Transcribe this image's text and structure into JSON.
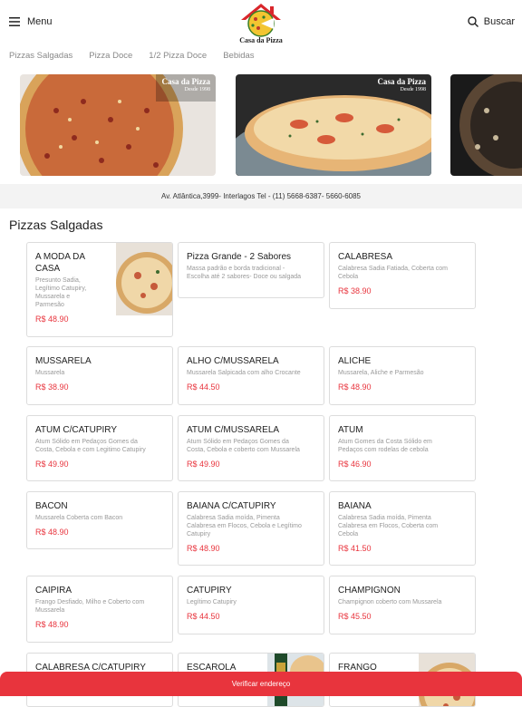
{
  "header": {
    "menu_label": "Menu",
    "logo_text": "Casa da Pizza",
    "search_label": "Buscar"
  },
  "tabs": [
    "Pizzas Salgadas",
    "Pizza Doce",
    "1/2 Pizza Doce",
    "Bebidas"
  ],
  "banners": [
    {
      "title": "Casa da Pizza",
      "subtitle": "Desde 1998"
    },
    {
      "title": "Casa da Pizza",
      "subtitle": "Desde 1998"
    }
  ],
  "address": "Av. Atlântica,3999- Interlagos Tel - (11) 5668-6387- 5660-6085",
  "section_title": "Pizzas Salgadas",
  "products": [
    {
      "name_lines": [
        "A MODA DA",
        "CASA"
      ],
      "desc_lines": [
        "Presunto Sadia,",
        "Legítimo Catupiry,",
        "Mussarela e",
        "Parmesão"
      ],
      "price": "R$ 48.90",
      "image": "pizza-photo"
    },
    {
      "name_lines": [
        "Pizza Grande - 2 Sabores"
      ],
      "desc_lines": [
        "Massa padrão e borda tradicional -",
        "Escolha até 2 sabores- Doce ou salgada"
      ],
      "price": ""
    },
    {
      "name_lines": [
        "CALABRESA"
      ],
      "desc_lines": [
        "Calabresa Sadia Fatiada, Coberta com",
        "Cebola"
      ],
      "price": "R$ 38.90"
    },
    {
      "name_lines": [
        "MUSSARELA"
      ],
      "desc_lines": [
        "Mussarela"
      ],
      "price": "R$ 38.90"
    },
    {
      "name_lines": [
        "ALHO C/MUSSARELA"
      ],
      "desc_lines": [
        "Mussarela Salpicada com alho Crocante"
      ],
      "price": "R$ 44.50"
    },
    {
      "name_lines": [
        "ALICHE"
      ],
      "desc_lines": [
        "Mussarela, Aliche e Parmesão"
      ],
      "price": "R$ 48.90"
    },
    {
      "name_lines": [
        "ATUM C/CATUPIRY"
      ],
      "desc_lines": [
        "Atum Sólido em Pedaços Gomes da",
        "Costa, Cebola e com Legitimo Catupiry"
      ],
      "price": "R$ 49.90"
    },
    {
      "name_lines": [
        "ATUM C/MUSSARELA"
      ],
      "desc_lines": [
        "Atum Sólido em Pedaços Gomes da",
        "Costa, Cebola e coberto com Mussarela"
      ],
      "price": "R$ 49.90"
    },
    {
      "name_lines": [
        "ATUM"
      ],
      "desc_lines": [
        "Atum Gomes da Costa Sólido em",
        "Pedaços com rodelas de cebola"
      ],
      "price": "R$ 46.90"
    },
    {
      "name_lines": [
        "BACON"
      ],
      "desc_lines": [
        "Mussarela Coberta com Bacon"
      ],
      "price": "R$ 48.90"
    },
    {
      "name_lines": [
        "BAIANA C/CATUPIRY"
      ],
      "desc_lines": [
        "Calabresa Sadia moída, Pimenta",
        "Calabresa em Flocos, Cebola e Legítimo",
        "Catupiry"
      ],
      "price": "R$ 48.90"
    },
    {
      "name_lines": [
        "BAIANA"
      ],
      "desc_lines": [
        "Calabresa Sadia moída, Pimenta",
        "Calabresa em Flocos, Coberta com",
        "Cebola"
      ],
      "price": "R$ 41.50"
    },
    {
      "name_lines": [
        "CAIPIRA"
      ],
      "desc_lines": [
        "Frango Desfiado, Milho e Coberto com",
        "Mussarela"
      ],
      "price": "R$ 48.90"
    },
    {
      "name_lines": [
        "CATUPIRY"
      ],
      "desc_lines": [
        "Legítimo Catupiry"
      ],
      "price": "R$ 44.50"
    },
    {
      "name_lines": [
        "CHAMPIGNON"
      ],
      "desc_lines": [
        "Champignon coberto com Mussarela"
      ],
      "price": "R$ 45.50"
    },
    {
      "name_lines": [
        "CALABRESA C/CATUPIRY"
      ],
      "desc_lines": [],
      "price": ""
    },
    {
      "name_lines": [
        "ESCAROLA"
      ],
      "desc_lines": [],
      "price": "",
      "image": "bottle-photo"
    },
    {
      "name_lines": [
        "FRANGO"
      ],
      "desc_lines": [],
      "price": "",
      "image": "pizza-photo"
    }
  ],
  "bottom_button": "Verificar endereço",
  "colors": {
    "accent": "#e8343d",
    "price": "#e8343d",
    "address_bg": "#f3f3f3"
  }
}
